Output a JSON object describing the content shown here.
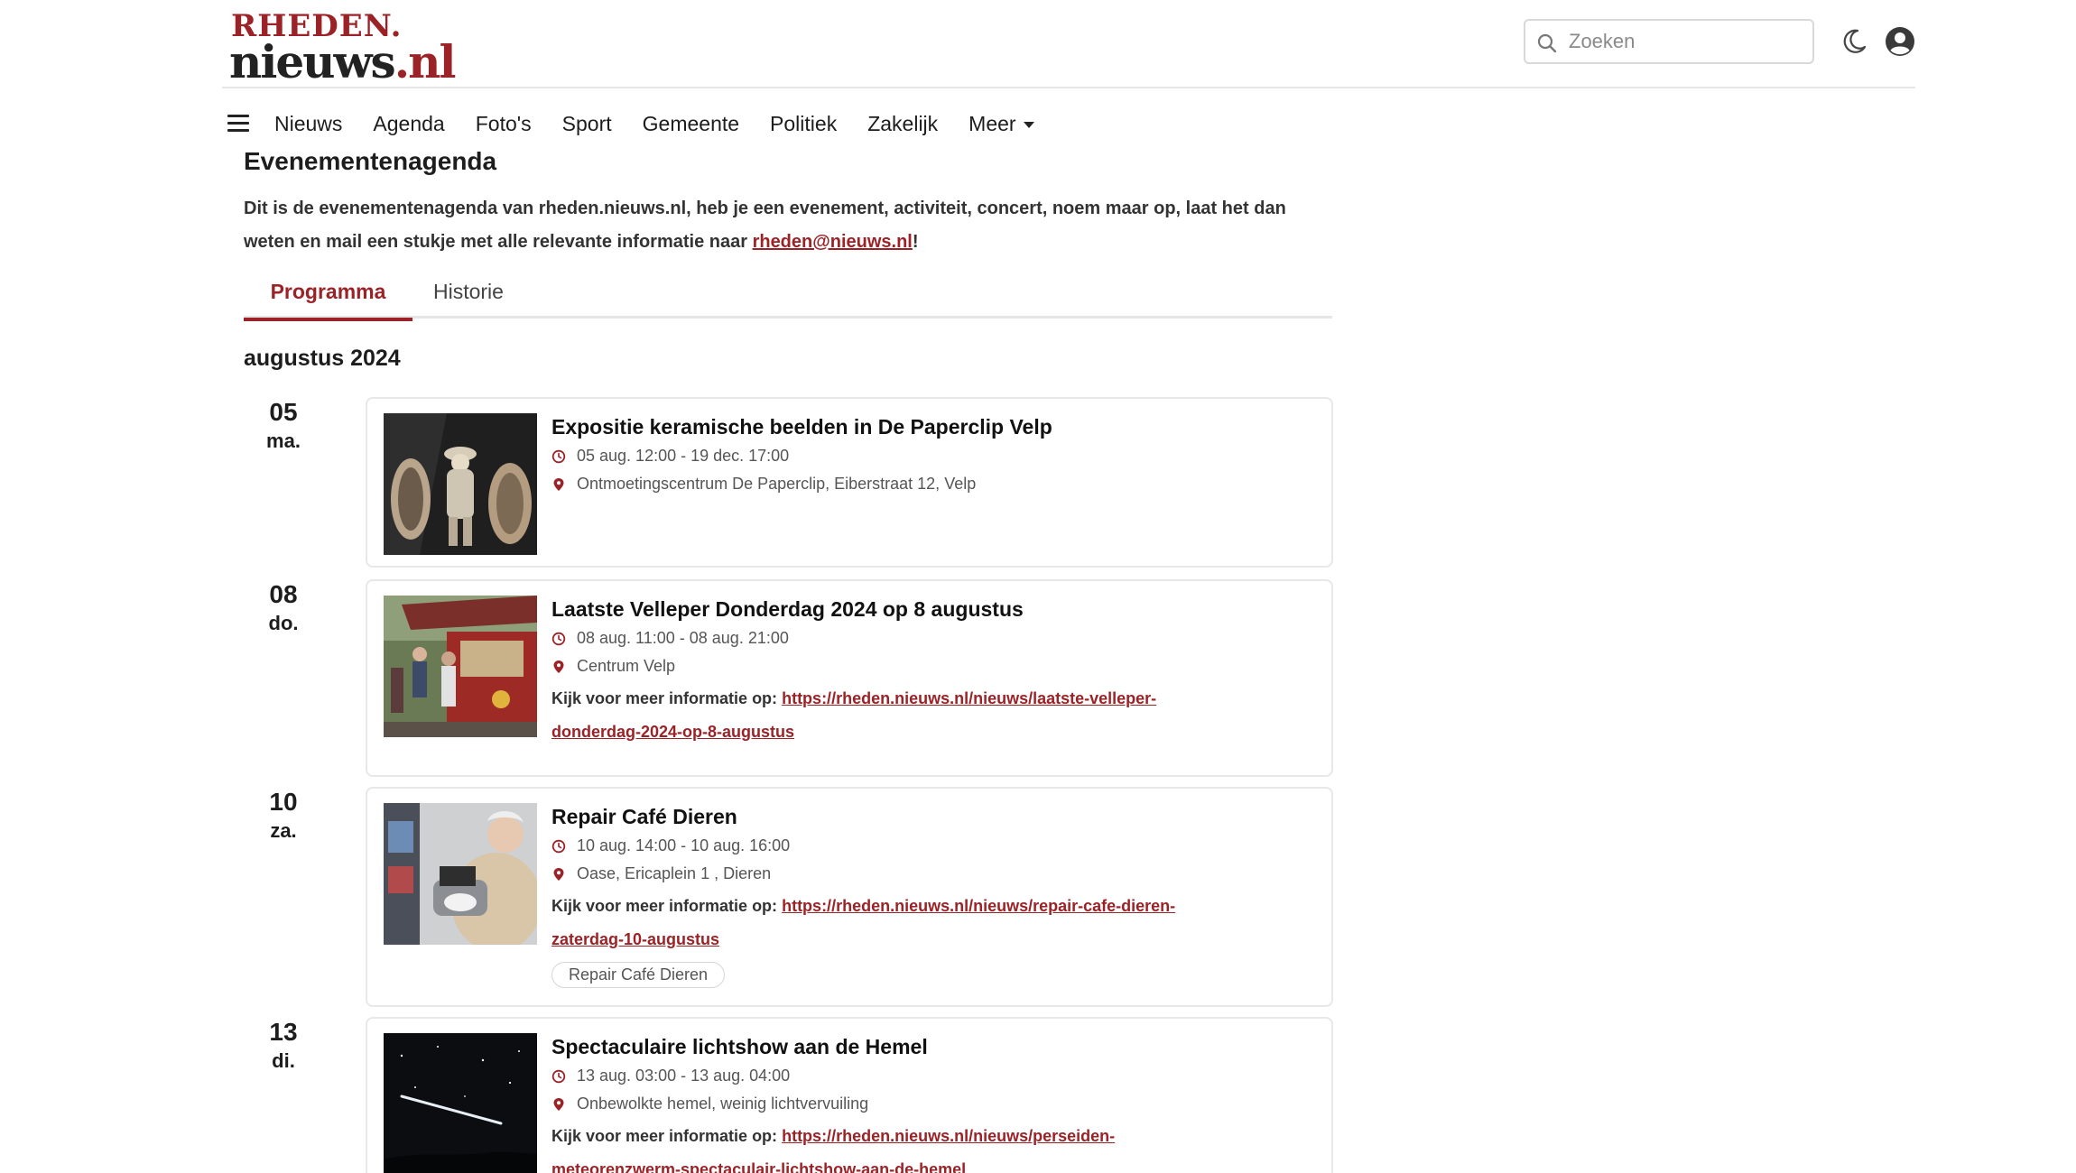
{
  "header": {
    "logo_top": "RHEDEN.",
    "logo_main": "nieuws",
    "logo_suffix": ".nl",
    "search_placeholder": "Zoeken",
    "icons": {
      "search": "search-icon",
      "theme": "moon-icon",
      "account": "user-icon"
    }
  },
  "nav": {
    "menu_icon": "hamburger-icon",
    "items": [
      "Nieuws",
      "Agenda",
      "Foto's",
      "Sport",
      "Gemeente",
      "Politiek",
      "Zakelijk",
      "Meer"
    ]
  },
  "page": {
    "title": "Evenementenagenda",
    "intro_text": "Dit is de evenementenagenda van rheden.nieuws.nl, heb je een evenement, activiteit, concert, noem maar op, laat het dan weten en mail een stukje met alle relevante informatie naar ",
    "intro_email": "rheden@nieuws.nl",
    "intro_end": "!",
    "tabs": [
      "Programma",
      "Historie"
    ],
    "active_tab": "Programma",
    "month": "augustus 2024"
  },
  "events": [
    {
      "day": "05",
      "weekday": "ma.",
      "title": "Expositie keramische beelden in De Paperclip Velp",
      "time": "05 aug. 12:00 - 19 dec. 17:00",
      "location": "Ontmoetingscentrum De Paperclip, Eiberstraat 12, Velp"
    },
    {
      "day": "08",
      "weekday": "do.",
      "title": "Laatste Velleper Donderdag 2024 op 8 augustus",
      "time": "08 aug. 11:00 - 08 aug. 21:00",
      "location": "Centrum Velp",
      "more_label": "Kijk voor meer informatie op:",
      "more_url_1": "https://rheden.nieuws.nl/nieuws/laatste-velleper-",
      "more_url_2": "donderdag-2024-op-8-augustus"
    },
    {
      "day": "10",
      "weekday": "za.",
      "title": "Repair Café Dieren",
      "time": "10 aug. 14:00 - 10 aug. 16:00",
      "location": "Oase, Ericaplein 1 , Dieren",
      "more_label": "Kijk voor meer informatie op:",
      "more_url_1": "https://rheden.nieuws.nl/nieuws/repair-cafe-dieren-",
      "more_url_2": "zaterdag-10-augustus",
      "tag": "Repair Café Dieren"
    },
    {
      "day": "13",
      "weekday": "di.",
      "title": "Spectaculaire lichtshow aan de Hemel",
      "time": "13 aug. 03:00 - 13 aug. 04:00",
      "location": "Onbewolkte hemel, weinig lichtvervuiling",
      "more_label": "Kijk voor meer informatie op:",
      "more_url_1": "https://rheden.nieuws.nl/nieuws/perseiden-",
      "more_url_2": "meteorenzwerm-spectaculair-lichtshow-aan-de-hemel"
    }
  ],
  "colors": {
    "brand": "#9b2226",
    "text": "#1d1d1d",
    "muted": "#555555",
    "border": "#e8e8e8"
  }
}
